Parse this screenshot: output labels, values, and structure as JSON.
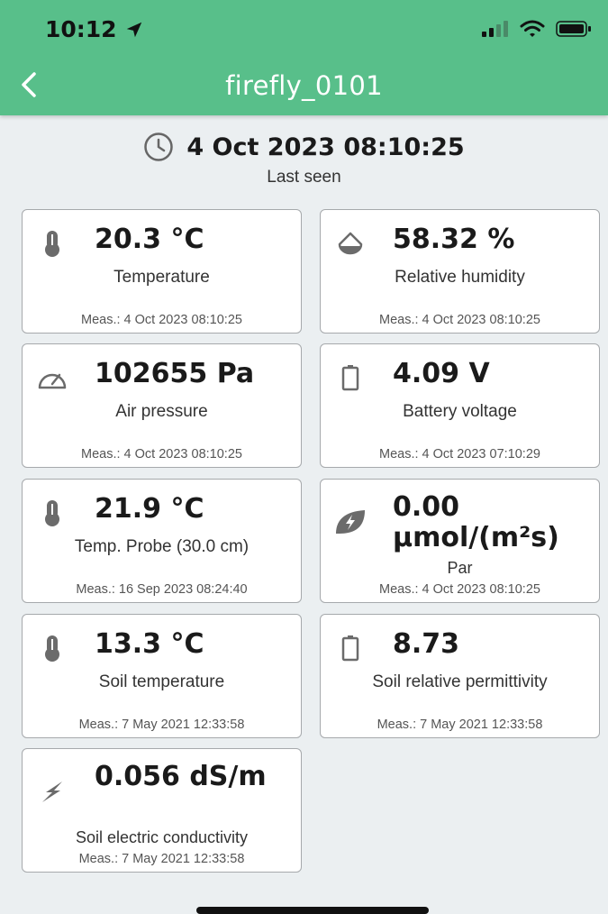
{
  "status_bar": {
    "time": "10:12",
    "location_icon": "location-arrow-icon",
    "signal_icon": "cellular-signal-icon",
    "wifi_icon": "wifi-icon",
    "battery_icon": "battery-icon"
  },
  "header": {
    "title": "firefly_0101",
    "back_icon": "chevron-left-icon",
    "background": "#58bf8a"
  },
  "last_seen": {
    "date": "4 Oct 2023 08:10:25",
    "label": "Last seen",
    "icon": "clock-icon"
  },
  "sensors": [
    {
      "icon": "thermometer-icon",
      "value": "20.3 °C",
      "label": "Temperature",
      "measured": "Meas.: 4 Oct 2023 08:10:25"
    },
    {
      "icon": "drop-icon",
      "value": "58.32 %",
      "label": "Relative humidity",
      "measured": "Meas.: 4 Oct 2023 08:10:25"
    },
    {
      "icon": "gauge-icon",
      "value": "102655 Pa",
      "label": "Air pressure",
      "measured": "Meas.: 4 Oct 2023 08:10:25"
    },
    {
      "icon": "battery-icon",
      "value": "4.09 V",
      "label": "Battery voltage",
      "measured": "Meas.: 4 Oct 2023 07:10:29"
    },
    {
      "icon": "thermometer-icon",
      "value": "21.9 °C",
      "label": "Temp. Probe (30.0 cm)",
      "measured": "Meas.: 16 Sep 2023 08:24:40"
    },
    {
      "icon": "leaf-bolt-icon",
      "value": "0.00 µmol/(m²s)",
      "label": "Par",
      "measured": "Meas.: 4 Oct 2023 08:10:25"
    },
    {
      "icon": "thermometer-icon",
      "value": "13.3 °C",
      "label": "Soil temperature",
      "measured": "Meas.: 7 May 2021 12:33:58"
    },
    {
      "icon": "battery-icon",
      "value": "8.73",
      "label": "Soil relative permittivity",
      "measured": "Meas.: 7 May 2021 12:33:58"
    },
    {
      "icon": "bolt-icon",
      "value": "0.056 dS/m",
      "label": "Soil electric conductivity",
      "measured": "Meas.: 7 May 2021 12:33:58"
    }
  ]
}
